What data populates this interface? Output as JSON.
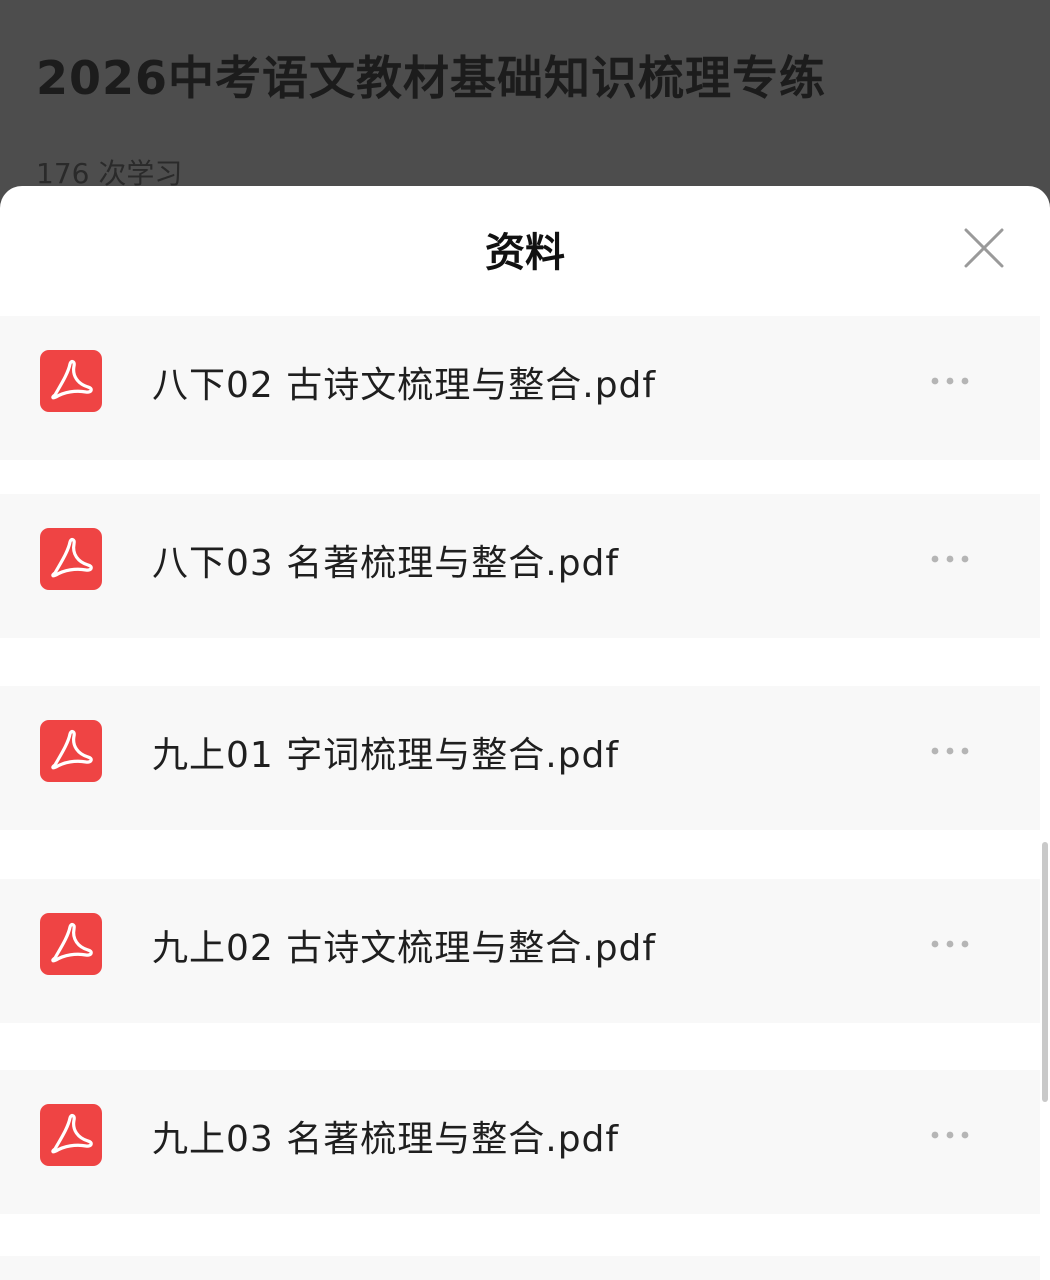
{
  "background_page": {
    "course_title": "2026中考语文教材基础知识梳理专练",
    "study_count": "176 次学习"
  },
  "sheet": {
    "title": "资料",
    "close_icon": "close-icon",
    "files": [
      {
        "name": "八下02 古诗文梳理与整合.pdf",
        "icon": "pdf-icon",
        "more_icon": "more-icon"
      },
      {
        "name": "八下03 名著梳理与整合.pdf",
        "icon": "pdf-icon",
        "more_icon": "more-icon"
      },
      {
        "name": "九上01 字词梳理与整合.pdf",
        "icon": "pdf-icon",
        "more_icon": "more-icon"
      },
      {
        "name": "九上02 古诗文梳理与整合.pdf",
        "icon": "pdf-icon",
        "more_icon": "more-icon"
      },
      {
        "name": "九上03 名著梳理与整合.pdf",
        "icon": "pdf-icon",
        "more_icon": "more-icon"
      }
    ]
  },
  "colors": {
    "pdf_icon": "#ef4444",
    "row_background": "#f8f8f8",
    "overlay": "#4d4d4d"
  }
}
